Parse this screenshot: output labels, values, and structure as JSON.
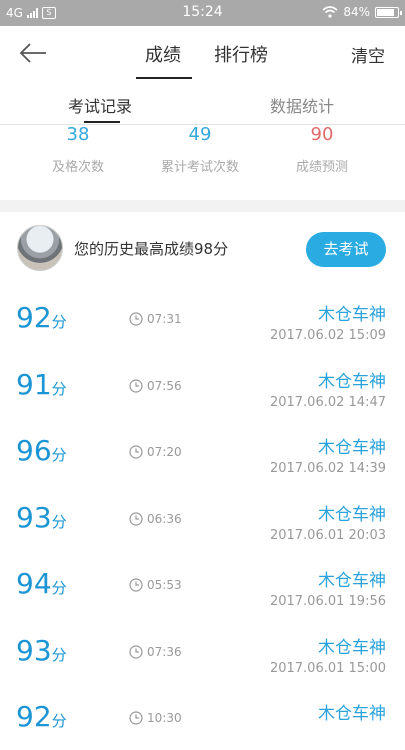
{
  "status_bar": {
    "network": "4G",
    "sim_label": "S",
    "time": "15:24",
    "battery": "84%"
  },
  "nav": {
    "tabs": [
      "成绩",
      "排行榜"
    ],
    "action": "清空"
  },
  "subtabs": [
    "考试记录",
    "数据统计"
  ],
  "stats": [
    {
      "value": "38",
      "label": "及格次数"
    },
    {
      "value": "49",
      "label": "累计考试次数"
    },
    {
      "value": "90",
      "label": "成绩预测"
    }
  ],
  "best": {
    "text": "您的历史最高成绩98分",
    "button": "去考试"
  },
  "score_unit": "分",
  "records": [
    {
      "score": "92",
      "duration": "07:31",
      "name": "木仓车神",
      "date": "2017.06.02  15:09"
    },
    {
      "score": "91",
      "duration": "07:56",
      "name": "木仓车神",
      "date": "2017.06.02  14:47"
    },
    {
      "score": "96",
      "duration": "07:20",
      "name": "木仓车神",
      "date": "2017.06.02  14:39"
    },
    {
      "score": "93",
      "duration": "06:36",
      "name": "木仓车神",
      "date": "2017.06.01  20:03"
    },
    {
      "score": "94",
      "duration": "05:53",
      "name": "木仓车神",
      "date": "2017.06.01  19:56"
    },
    {
      "score": "93",
      "duration": "07:36",
      "name": "木仓车神",
      "date": "2017.06.01  15:00"
    },
    {
      "score": "92",
      "duration": "10:30",
      "name": "木仓车神",
      "date": ""
    }
  ]
}
